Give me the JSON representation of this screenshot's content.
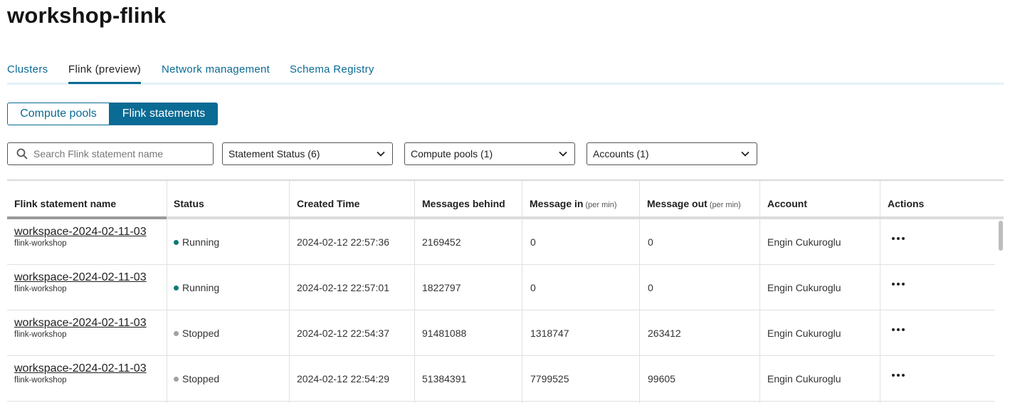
{
  "page": {
    "title": "workshop-flink"
  },
  "tabs": [
    {
      "label": "Clusters",
      "active": false
    },
    {
      "label": "Flink (preview)",
      "active": true
    },
    {
      "label": "Network management",
      "active": false
    },
    {
      "label": "Schema Registry",
      "active": false
    }
  ],
  "segmented": {
    "compute_pools": "Compute pools",
    "flink_statements": "Flink statements",
    "selected": "Flink statements"
  },
  "filters": {
    "search_placeholder": "Search Flink statement name",
    "statement_status": "Statement Status (6)",
    "compute_pools": "Compute pools (1)",
    "accounts": "Accounts (1)"
  },
  "table": {
    "columns": {
      "name": "Flink statement name",
      "status": "Status",
      "created": "Created Time",
      "behind": "Messages behind",
      "msg_in": "Message in",
      "msg_in_unit": "(per min)",
      "msg_out": "Message out",
      "msg_out_unit": "(per min)",
      "account": "Account",
      "actions": "Actions"
    },
    "rows": [
      {
        "name": "workspace-2024-02-11-03",
        "pool": "flink-workshop",
        "status": "Running",
        "created": "2024-02-12 22:57:36",
        "behind": "2169452",
        "msg_in": "0",
        "msg_out": "0",
        "account": "Engin Cukuroglu"
      },
      {
        "name": "workspace-2024-02-11-03",
        "pool": "flink-workshop",
        "status": "Running",
        "created": "2024-02-12 22:57:01",
        "behind": "1822797",
        "msg_in": "0",
        "msg_out": "0",
        "account": "Engin Cukuroglu"
      },
      {
        "name": "workspace-2024-02-11-03",
        "pool": "flink-workshop",
        "status": "Stopped",
        "created": "2024-02-12 22:54:37",
        "behind": "91481088",
        "msg_in": "1318747",
        "msg_out": "263412",
        "account": "Engin Cukuroglu"
      },
      {
        "name": "workspace-2024-02-11-03",
        "pool": "flink-workshop",
        "status": "Stopped",
        "created": "2024-02-12 22:54:29",
        "behind": "51384391",
        "msg_in": "7799525",
        "msg_out": "99605",
        "account": "Engin Cukuroglu"
      }
    ]
  },
  "colors": {
    "accent": "#0a6b94",
    "running": "#0b7a73",
    "stopped": "#a0a0a8"
  },
  "icons": {
    "search": "search-icon",
    "dropdown": "chevron-down-icon",
    "actions": "more-horizontal-icon"
  }
}
